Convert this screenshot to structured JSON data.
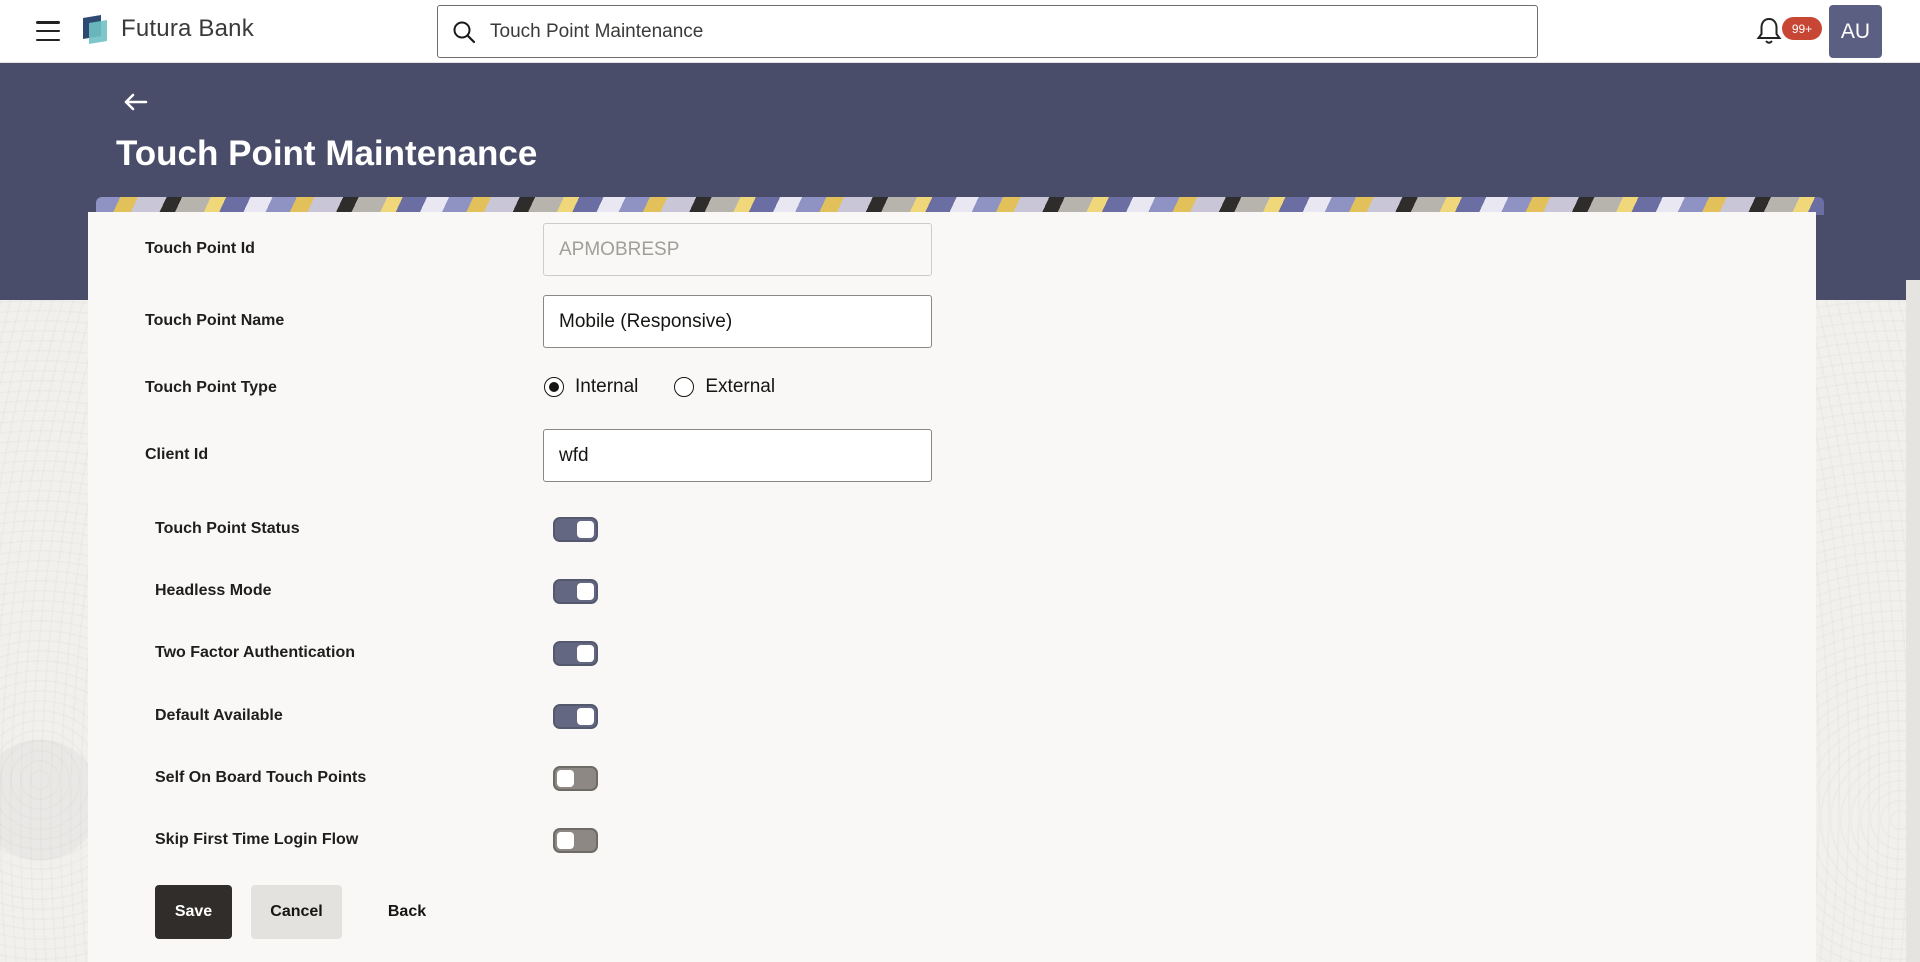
{
  "header": {
    "app_name": "Futura Bank",
    "search_value": "Touch Point Maintenance",
    "notification_count": "99+",
    "avatar_initials": "AU"
  },
  "page": {
    "title": "Touch Point Maintenance"
  },
  "form": {
    "touch_point_id": {
      "label": "Touch Point Id",
      "value": "APMOBRESP"
    },
    "touch_point_name": {
      "label": "Touch Point Name",
      "value": "Mobile (Responsive)"
    },
    "touch_point_type": {
      "label": "Touch Point Type",
      "options": [
        "Internal",
        "External"
      ],
      "selected": "Internal"
    },
    "client_id": {
      "label": "Client Id",
      "value": "wfd"
    },
    "toggles": [
      {
        "label": "Touch Point Status",
        "on": true
      },
      {
        "label": "Headless Mode",
        "on": true
      },
      {
        "label": "Two Factor Authentication",
        "on": true
      },
      {
        "label": "Default Available",
        "on": true
      },
      {
        "label": "Self On Board Touch Points",
        "on": false
      },
      {
        "label": "Skip First Time Login Flow",
        "on": false
      }
    ]
  },
  "actions": {
    "save": "Save",
    "cancel": "Cancel",
    "back": "Back"
  },
  "colors": {
    "banner": "#4a4d6a",
    "toggle_on": "#636781",
    "toggle_off": "#8d8883",
    "primary_button": "#312d2a",
    "badge": "#c74634"
  }
}
